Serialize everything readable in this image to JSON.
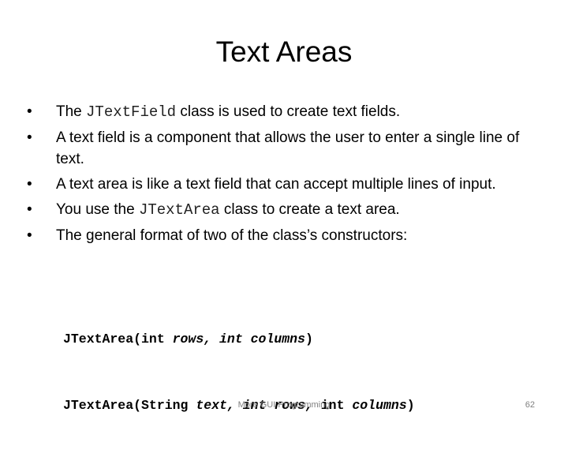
{
  "slide": {
    "title": "Text Areas",
    "bullets": [
      {
        "parts": [
          {
            "text": "The ",
            "mono": false
          },
          {
            "text": "JTextField",
            "mono": true
          },
          {
            "text": " class is used to create text fields.",
            "mono": false
          }
        ]
      },
      {
        "parts": [
          {
            "text": "A text field is a component that allows the user to enter a single line of text.",
            "mono": false
          }
        ]
      },
      {
        "parts": [
          {
            "text": "A text area is like a text field that can accept multiple lines of input.",
            "mono": false
          }
        ]
      },
      {
        "parts": [
          {
            "text": "You use the ",
            "mono": false
          },
          {
            "text": "JTextArea",
            "mono": true
          },
          {
            "text": " class to create a text area.",
            "mono": false
          }
        ]
      },
      {
        "parts": [
          {
            "text": "The general format of two of the class’s constructors:",
            "mono": false
          }
        ]
      }
    ],
    "constructors": [
      [
        {
          "text": "JTextArea(int ",
          "italic": false
        },
        {
          "text": "rows, int columns",
          "italic": true
        },
        {
          "text": ")",
          "italic": false
        }
      ],
      [
        {
          "text": "JTextArea(String ",
          "italic": false
        },
        {
          "text": "text, int rows, ",
          "italic": true
        },
        {
          "text": "int ",
          "italic": false
        },
        {
          "text": "columns",
          "italic": true
        },
        {
          "text": ")",
          "italic": false
        }
      ]
    ],
    "footer": "More GUI Programming",
    "page_number": "62"
  }
}
